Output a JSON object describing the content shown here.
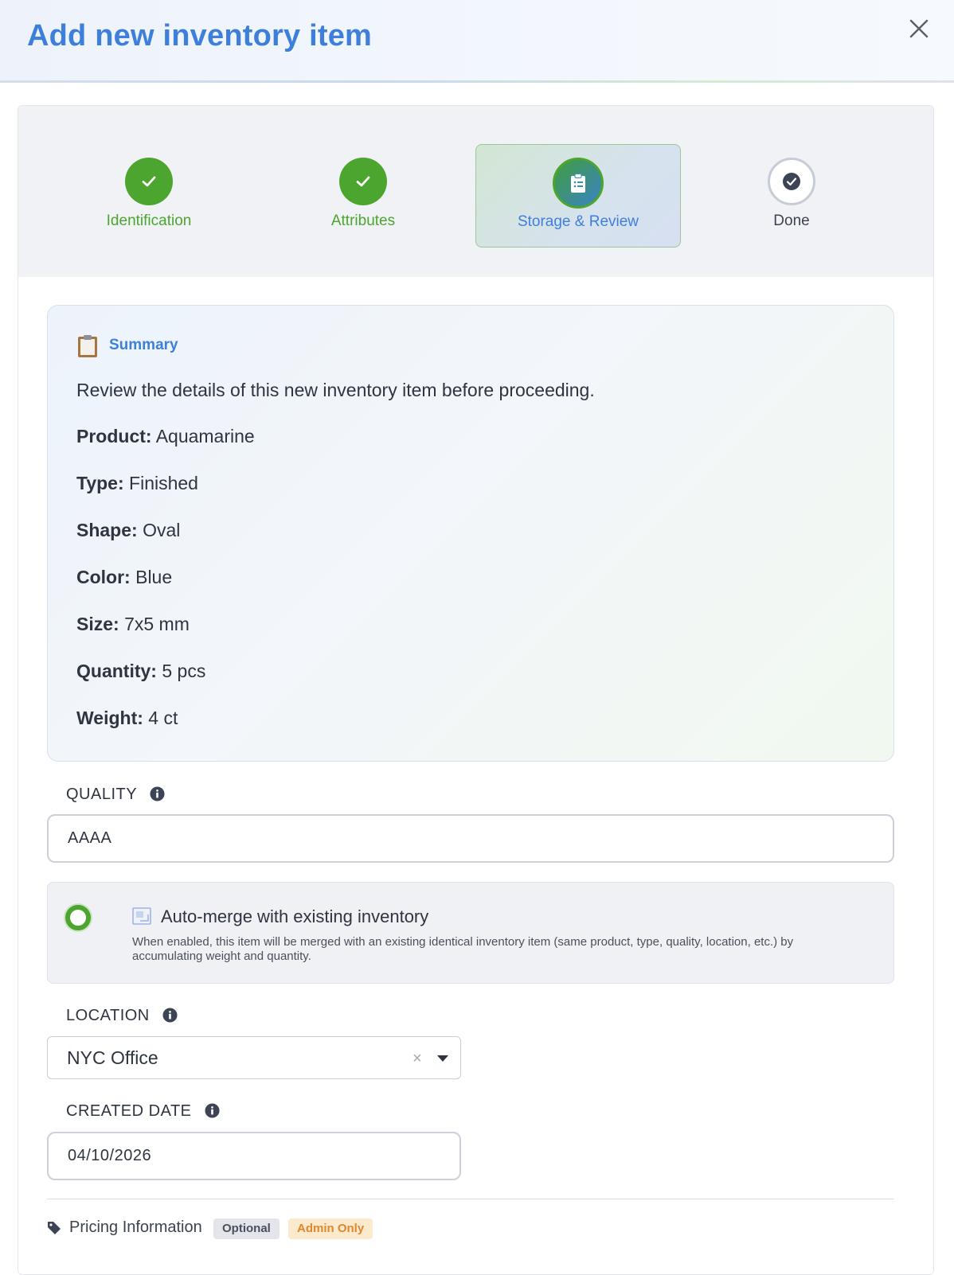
{
  "header": {
    "title": "Add new inventory item"
  },
  "stepper": {
    "steps": [
      {
        "label": "Identification",
        "state": "complete"
      },
      {
        "label": "Attributes",
        "state": "complete"
      },
      {
        "label": "Storage & Review",
        "state": "active"
      },
      {
        "label": "Done",
        "state": "pending"
      }
    ]
  },
  "summary": {
    "heading": "Summary",
    "intro": "Review the details of this new inventory item before proceeding.",
    "fields": [
      {
        "label": "Product:",
        "value": "Aquamarine"
      },
      {
        "label": "Type:",
        "value": "Finished"
      },
      {
        "label": "Shape:",
        "value": "Oval"
      },
      {
        "label": "Color:",
        "value": "Blue"
      },
      {
        "label": "Size:",
        "value": "7x5 mm"
      },
      {
        "label": "Quantity:",
        "value": "5 pcs"
      },
      {
        "label": "Weight:",
        "value": "4 ct"
      }
    ]
  },
  "quality": {
    "label": "QUALITY",
    "value": "AAAA"
  },
  "auto_merge": {
    "title": "Auto-merge with existing inventory",
    "description": "When enabled, this item will be merged with an existing identical inventory item (same product, type, quality, location, etc.) by accumulating weight and quantity.",
    "enabled": true
  },
  "location": {
    "label": "LOCATION",
    "value": "NYC Office",
    "clear_glyph": "×"
  },
  "created_date": {
    "label": "CREATED DATE",
    "value": "04/10/2026"
  },
  "pricing": {
    "label": "Pricing Information",
    "badges": [
      "Optional",
      "Admin Only"
    ]
  },
  "colors": {
    "primary": "#3f7fdc",
    "success": "#4ca52e",
    "admin_badge_text": "#e0872d"
  },
  "icons": {
    "close": "close-icon",
    "check": "check-icon",
    "clipboard": "clipboard-icon",
    "info": "info-icon",
    "merge": "merge-icon",
    "tag": "tag-icon",
    "caret": "chevron-down-icon"
  }
}
